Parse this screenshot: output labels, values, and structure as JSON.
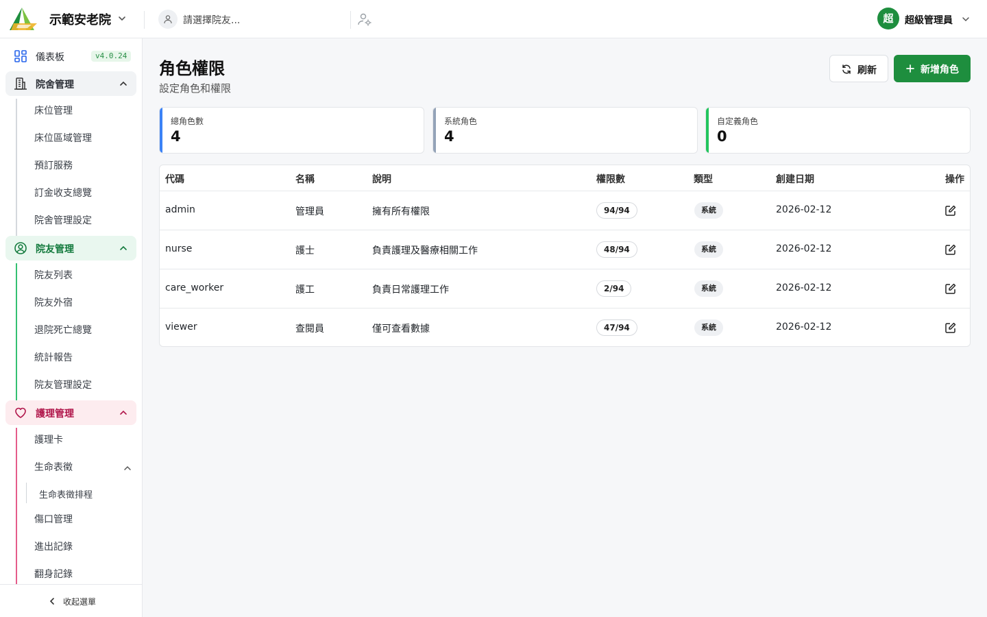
{
  "header": {
    "org_name": "示範安老院",
    "resident_placeholder": "請選擇院友...",
    "user_initial": "超",
    "user_name": "超級管理員"
  },
  "sidebar": {
    "dashboard": {
      "label": "儀表板",
      "version": "v4.0.24"
    },
    "facility": {
      "label": "院舍管理",
      "items": [
        "床位管理",
        "床位區域管理",
        "預訂服務",
        "訂金收支總覽",
        "院舍管理設定"
      ]
    },
    "residents": {
      "label": "院友管理",
      "items": [
        "院友列表",
        "院友外宿",
        "退院死亡總覽",
        "統計報告",
        "院友管理設定"
      ]
    },
    "care": {
      "label": "護理管理",
      "items": [
        "護理卡",
        "生命表徵",
        "傷口管理",
        "進出記錄",
        "翻身記錄"
      ],
      "vital_sub": [
        "生命表徵排程"
      ]
    },
    "collapse_label": "收起選單"
  },
  "colors": {
    "primary_green": "#1e8e3e",
    "resident_accent": "#137a3d",
    "care_accent": "#b0154a",
    "stat_total": "#3b82f6",
    "stat_system": "#94a3b8",
    "stat_custom": "#22c55e"
  },
  "page": {
    "title": "角色權限",
    "subtitle": "設定角色和權限",
    "refresh_label": "刷新",
    "add_label": "新增角色"
  },
  "stats": [
    {
      "label": "總角色數",
      "value": "4"
    },
    {
      "label": "系統角色",
      "value": "4"
    },
    {
      "label": "自定義角色",
      "value": "0"
    }
  ],
  "table": {
    "headers": [
      "代碼",
      "名稱",
      "說明",
      "權限數",
      "類型",
      "創建日期",
      "操作"
    ],
    "rows": [
      {
        "code": "admin",
        "name": "管理員",
        "desc": "擁有所有權限",
        "perms": "94/94",
        "type": "系統",
        "date": "2026-02-12"
      },
      {
        "code": "nurse",
        "name": "護士",
        "desc": "負責護理及醫療相關工作",
        "perms": "48/94",
        "type": "系統",
        "date": "2026-02-12"
      },
      {
        "code": "care_worker",
        "name": "護工",
        "desc": "負責日常護理工作",
        "perms": "2/94",
        "type": "系統",
        "date": "2026-02-12"
      },
      {
        "code": "viewer",
        "name": "查閱員",
        "desc": "僅可查看數據",
        "perms": "47/94",
        "type": "系統",
        "date": "2026-02-12"
      }
    ]
  }
}
